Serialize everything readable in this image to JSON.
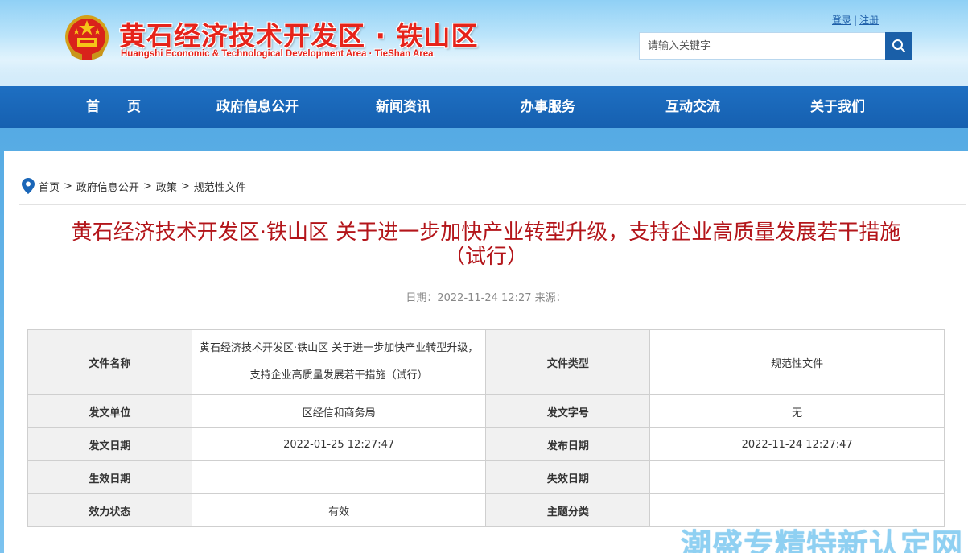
{
  "header": {
    "site_title": "黄石经济技术开发区 · 铁山区",
    "site_subtitle": "Huangshi Economic & Technological Development Area · TieShan Area",
    "login": "登录",
    "register": "注册",
    "search_placeholder": "请输入关键字"
  },
  "nav": {
    "items": [
      {
        "label": "首　　页"
      },
      {
        "label": "政府信息公开"
      },
      {
        "label": "新闻资讯"
      },
      {
        "label": "办事服务"
      },
      {
        "label": "互动交流"
      },
      {
        "label": "关于我们"
      }
    ]
  },
  "breadcrumb": [
    "首页",
    "政府信息公开",
    "政策",
    "规范性文件"
  ],
  "breadcrumb_sep": ">",
  "article": {
    "title_line1": "黄石经济技术开发区·铁山区 关于进一步加快产业转型升级，支持企业高质量发展若干措施",
    "title_line2": "（试行）",
    "meta": "日期：2022-11-24 12:27 来源："
  },
  "info_table": {
    "file_name_label": "文件名称",
    "file_name": "黄石经济技术开发区·铁山区 关于进一步加快产业转型升级，支持企业高质量发展若干措施（试行）",
    "file_type_label": "文件类型",
    "file_type": "规范性文件",
    "issuer_label": "发文单位",
    "issuer": "区经信和商务局",
    "doc_no_label": "发文字号",
    "doc_no": "无",
    "issue_date_label": "发文日期",
    "issue_date": "2022-01-25 12:27:47",
    "publish_date_label": "发布日期",
    "publish_date": "2022-11-24 12:27:47",
    "effective_date_label": "生效日期",
    "effective_date": "",
    "expire_date_label": "失效日期",
    "expire_date": "",
    "status_label": "效力状态",
    "status": "有效",
    "topic_label": "主题分类",
    "topic": ""
  },
  "watermark": "潮盛专精特新认定网",
  "colors": {
    "nav_blue": "#1a66b8",
    "title_red": "#b3151a",
    "brand_red": "#e6231a"
  }
}
